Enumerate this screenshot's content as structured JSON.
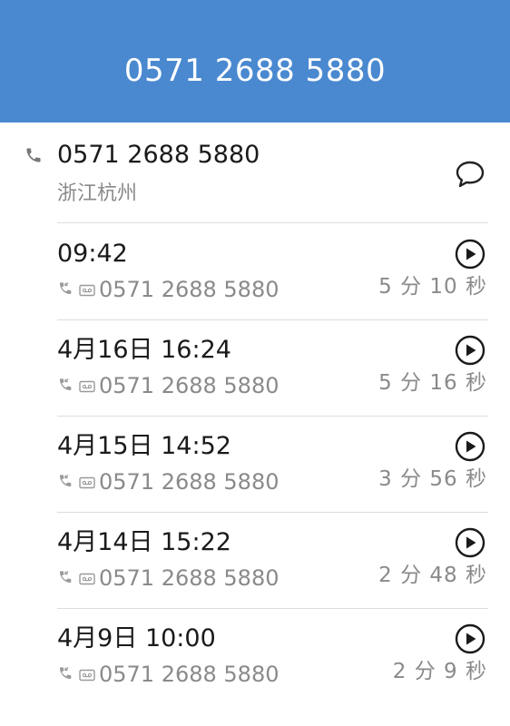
{
  "header": {
    "title": "0571 2688 5880"
  },
  "contact": {
    "number": "0571 2688 5880",
    "location": "浙江杭州",
    "icons": {
      "phone": "phone-icon",
      "message": "message-bubble-icon"
    }
  },
  "calls": [
    {
      "time": "09:42",
      "number": "0571 2688 5880",
      "duration": "5 分 10 秒"
    },
    {
      "time": "4月16日 16:24",
      "number": "0571 2688 5880",
      "duration": "5 分 16 秒"
    },
    {
      "time": "4月15日 14:52",
      "number": "0571 2688 5880",
      "duration": "3 分 56 秒"
    },
    {
      "time": "4月14日 15:22",
      "number": "0571 2688 5880",
      "duration": "2 分 48 秒"
    },
    {
      "time": "4月9日 10:00",
      "number": "0571 2688 5880",
      "duration": "2 分 9 秒"
    }
  ],
  "colors": {
    "header": "#4a89d0",
    "primary_text": "#1a1a1a",
    "secondary_text": "#8a8a8a"
  }
}
